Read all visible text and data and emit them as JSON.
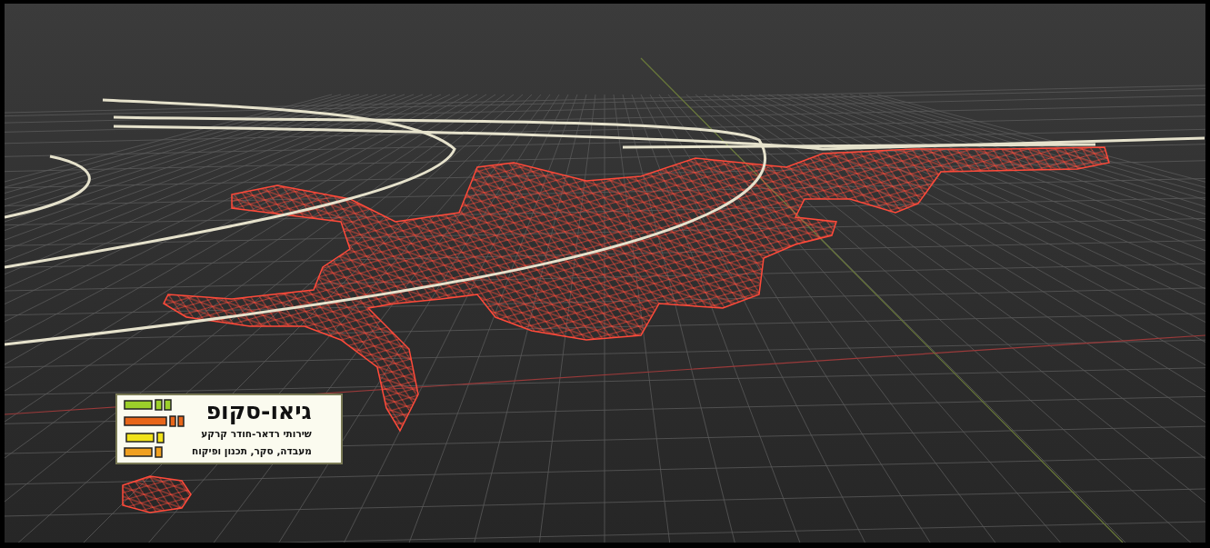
{
  "logo": {
    "title": "גיאו-סקופ",
    "taglines": [
      "שירותי רדאר-חודר קרקע",
      "מעבדה, סקר, תכנון ופיקוח"
    ]
  }
}
